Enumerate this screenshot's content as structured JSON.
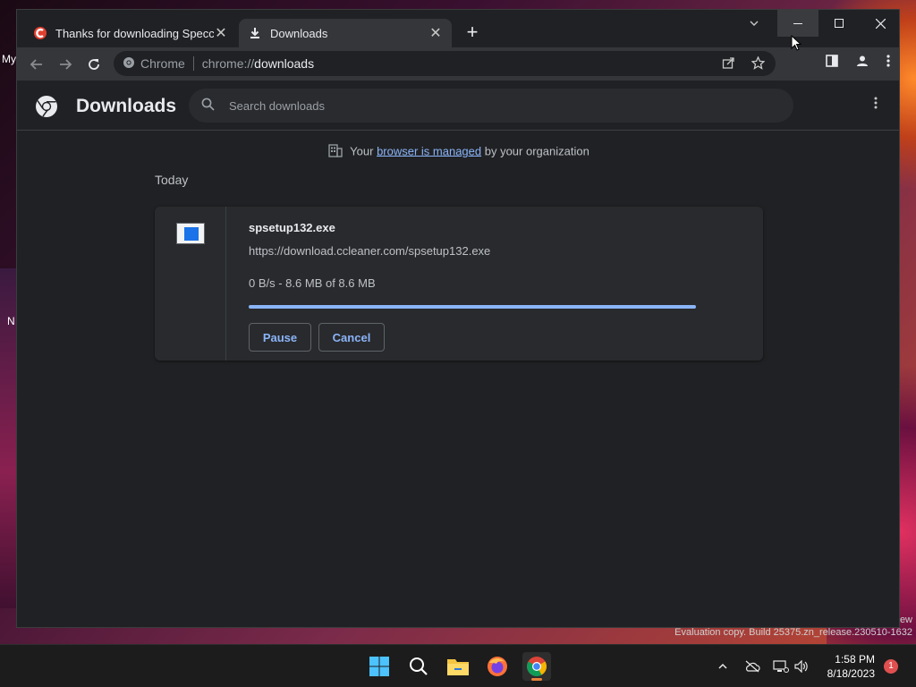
{
  "desktop": {
    "label_top": "My",
    "label_mid": "N",
    "watermark": "Evaluation copy. Build 25375.zn_release.230510-1632",
    "view_text": "ew"
  },
  "tabs": [
    {
      "title": "Thanks for downloading Speccy",
      "active": false
    },
    {
      "title": "Downloads",
      "active": true
    }
  ],
  "toolbar": {
    "chip_label": "Chrome",
    "url_scheme": "chrome://",
    "url_host": "downloads"
  },
  "page": {
    "title": "Downloads",
    "search_placeholder": "Search downloads",
    "managed_prefix": "Your ",
    "managed_link": "browser is managed",
    "managed_suffix": " by your organization",
    "section_today": "Today"
  },
  "download": {
    "filename": "spsetup132.exe",
    "url": "https://download.ccleaner.com/spsetup132.exe",
    "status": "0 B/s - 8.6 MB of 8.6 MB",
    "progress_fraction": 1.0,
    "pause_label": "Pause",
    "cancel_label": "Cancel"
  },
  "taskbar": {
    "time": "1:58 PM",
    "date": "8/18/2023",
    "notifications": "1"
  },
  "colors": {
    "accent": "#8ab4f8",
    "page_bg": "#202124",
    "card_bg": "#292a2d"
  }
}
